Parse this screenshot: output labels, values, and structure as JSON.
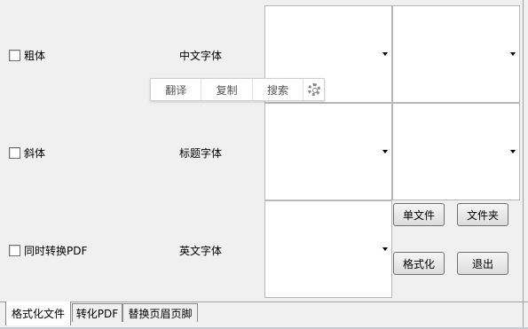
{
  "options": {
    "bold_label": "粗体",
    "italic_label": "斜体",
    "convert_pdf_label": "同时转换PDF"
  },
  "fonts": {
    "chinese_label": "中文字体",
    "title_label": "标题字体",
    "english_label": "英文字体"
  },
  "popup": {
    "translate": "翻译",
    "copy": "复制",
    "search": "搜索",
    "settings_icon": "gear-icon"
  },
  "actions": {
    "single_file": "单文件",
    "folder": "文件夹",
    "format": "格式化",
    "exit": "退出"
  },
  "tabs": {
    "format_file": "格式化文件",
    "to_pdf": "转化PDF",
    "header_footer": "替换页眉页脚"
  }
}
